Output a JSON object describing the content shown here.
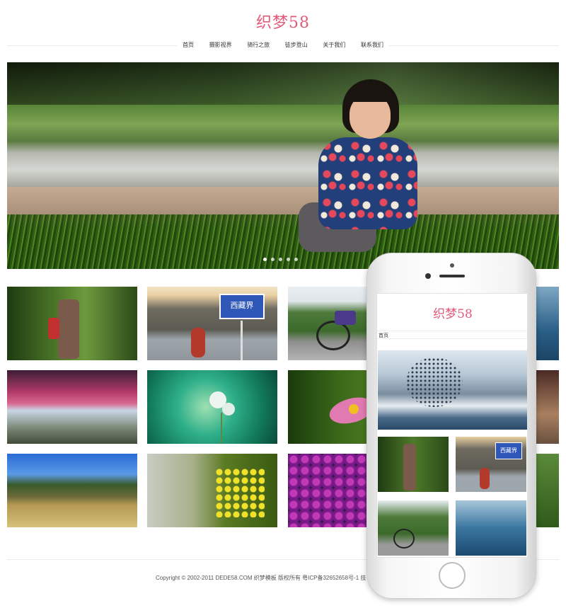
{
  "site": {
    "title": "织梦58"
  },
  "nav": {
    "items": [
      {
        "label": "首页"
      },
      {
        "label": "摄影视界"
      },
      {
        "label": "骑行之旅"
      },
      {
        "label": "徒步登山"
      },
      {
        "label": "关于我们"
      },
      {
        "label": "联系我们"
      }
    ]
  },
  "banner": {
    "slide_count": 5,
    "active_slide": 1
  },
  "gallery": {
    "sign_text": "西藏界"
  },
  "footer": {
    "copyright": "Copyright © 2002-2011 DEDE58.COM 织梦模板 版权所有 粤ICP备32652658号-1 技"
  },
  "mobile": {
    "title": "织梦58",
    "nav_label": "首页",
    "sign_text": "西藏界"
  },
  "colors": {
    "brand": "#e25a78",
    "divider": "#ececec"
  }
}
